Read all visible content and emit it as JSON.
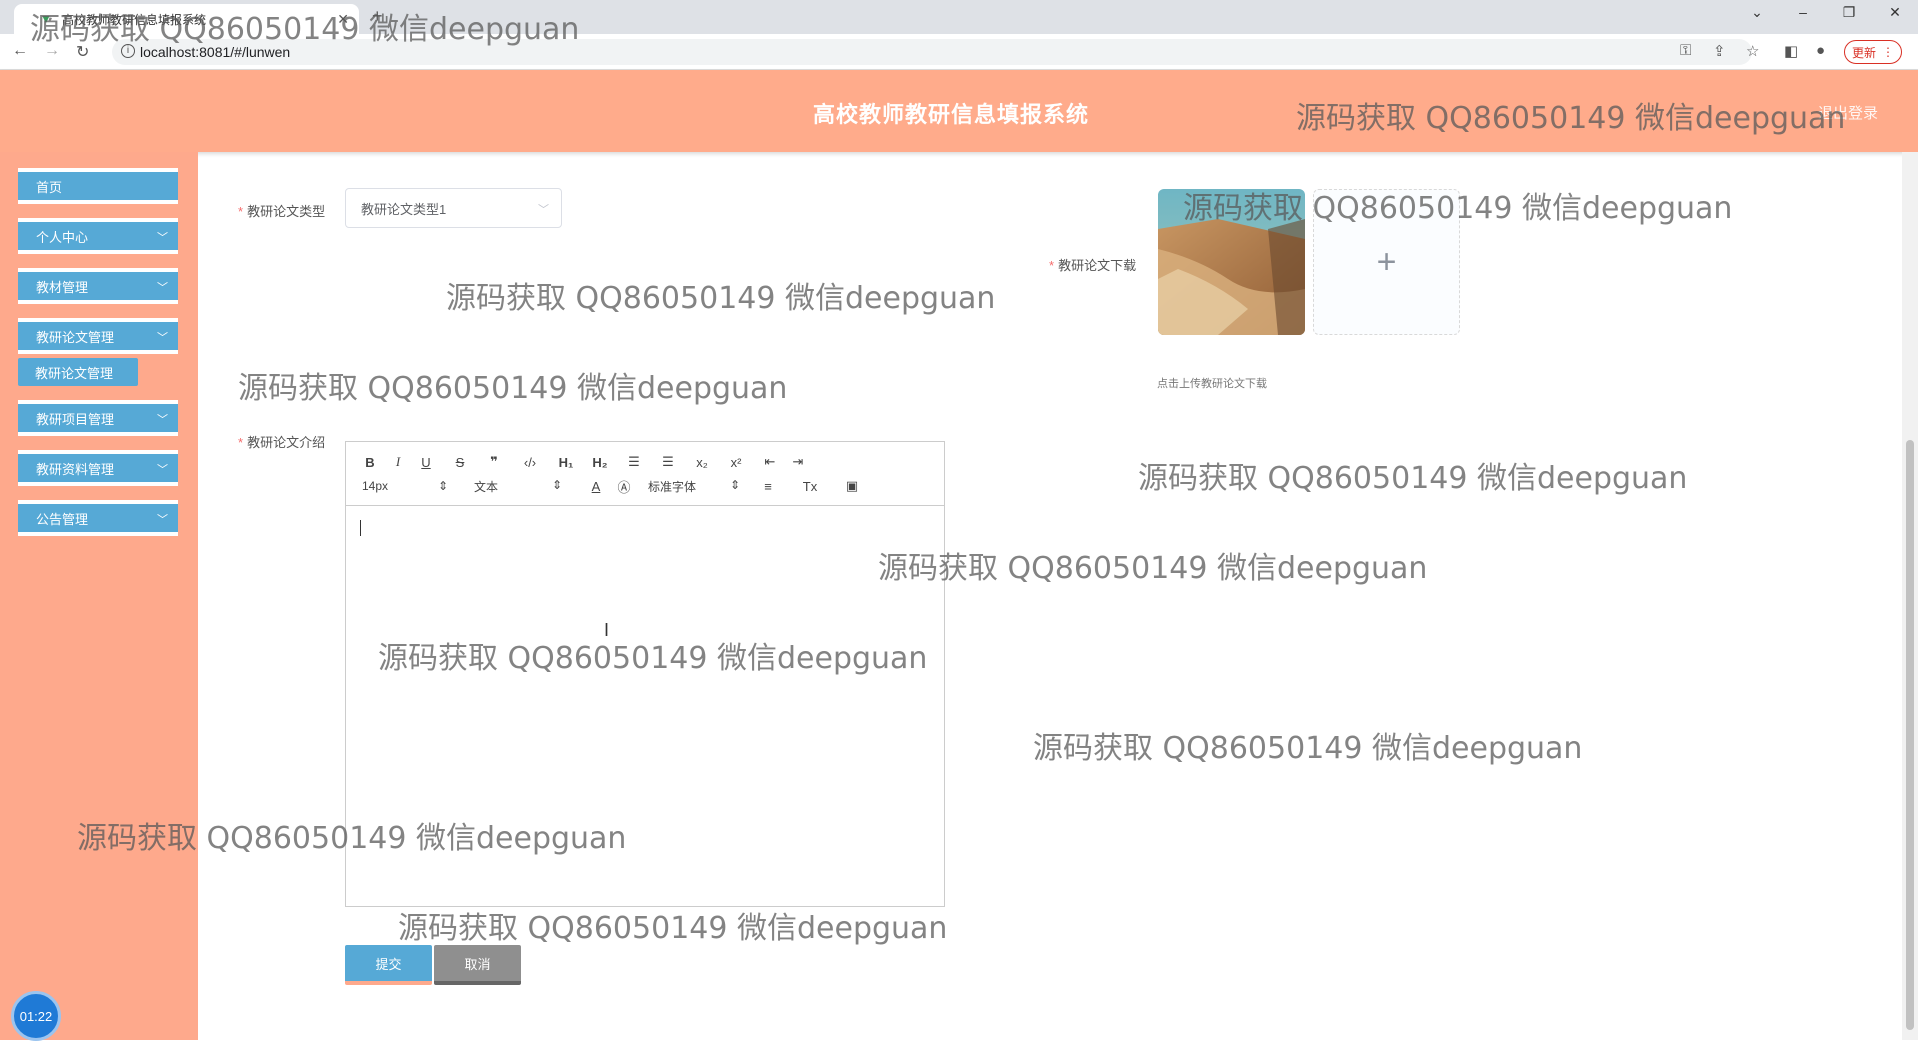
{
  "browser": {
    "tab_title": "高校教师教研信息填报系统",
    "url": "localhost:8081/#/lunwen",
    "update_label": "更新"
  },
  "header": {
    "title": "高校教师教研信息填报系统",
    "logout": "退出登录"
  },
  "sidebar": {
    "items": [
      {
        "label": "首页"
      },
      {
        "label": "个人中心"
      },
      {
        "label": "教材管理"
      },
      {
        "label": "教研论文管理"
      },
      {
        "label": "教研项目管理"
      },
      {
        "label": "教研资料管理"
      },
      {
        "label": "公告管理"
      }
    ],
    "active_sub": "教研论文管理"
  },
  "form": {
    "type_label": "教研论文类型",
    "type_value": "教研论文类型1",
    "download_label": "教研论文下载",
    "upload_tip": "点击上传教研论文下载",
    "intro_label": "教研论文介绍",
    "editor": {
      "font_size": "14px",
      "block_type": "文本",
      "font_family": "标准字体"
    },
    "submit": "提交",
    "cancel": "取消"
  },
  "timer": "01:22",
  "watermark": "源码获取 QQ86050149 微信deepguan",
  "colors": {
    "header_bg": "#ffab8b",
    "sidebar_bg": "#fea98c",
    "menu_bg": "#56a9d6",
    "cancel_bg": "#8f8f8f"
  }
}
